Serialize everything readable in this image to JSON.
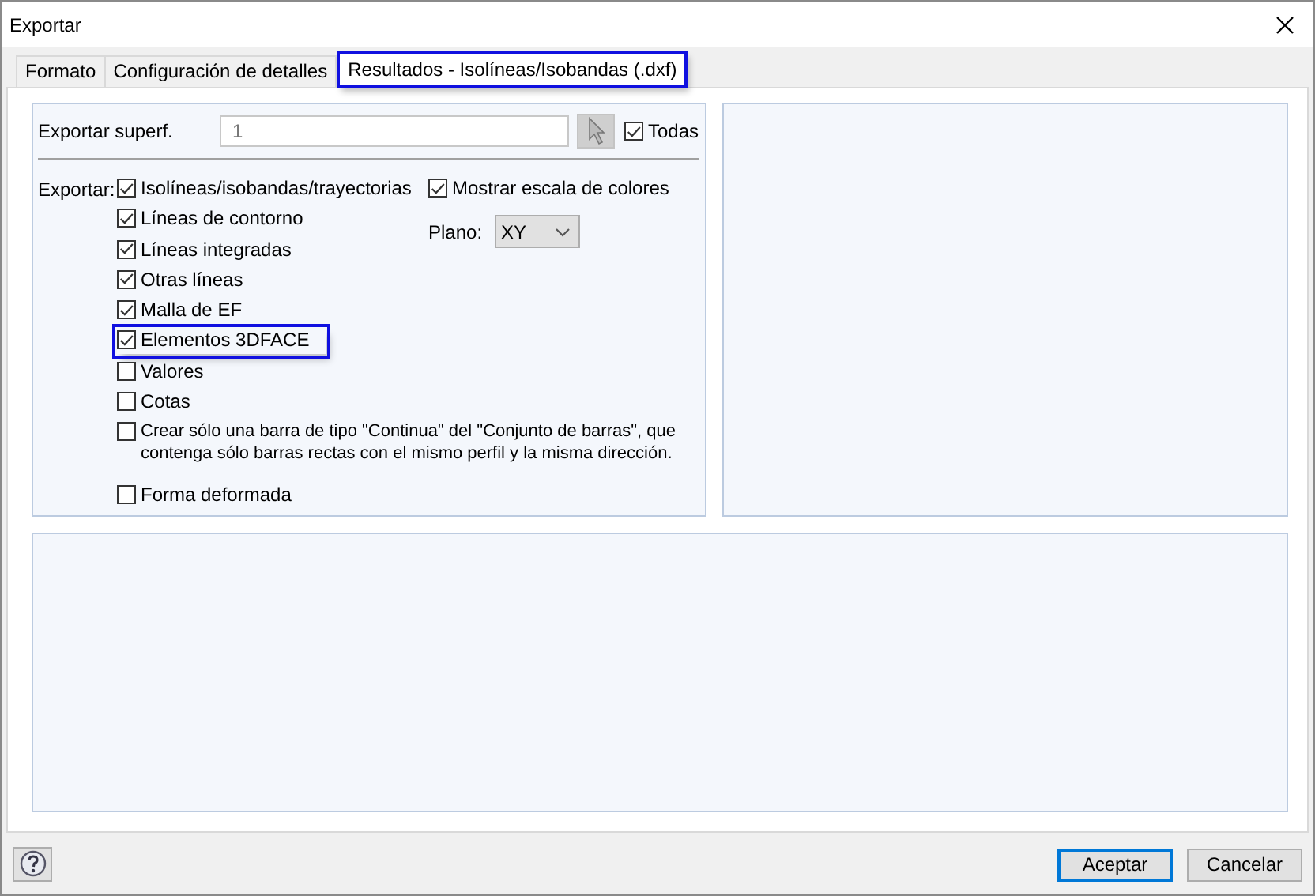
{
  "window": {
    "title": "Exportar"
  },
  "tabs": [
    {
      "label": "Formato",
      "selected": false,
      "highlighted": false
    },
    {
      "label": "Configuración de detalles",
      "selected": false,
      "highlighted": false
    },
    {
      "label": "Resultados - Isolíneas/Isobandas (.dxf)",
      "selected": true,
      "highlighted": true
    }
  ],
  "surface": {
    "label": "Exportar superf.",
    "value": "1",
    "all": {
      "label": "Todas",
      "checked": true
    }
  },
  "export": {
    "label": "Exportar:",
    "options": [
      {
        "label": "Isolíneas/isobandas/trayectorias",
        "checked": true,
        "highlighted": false
      },
      {
        "label": "Líneas de contorno",
        "checked": true,
        "highlighted": false
      },
      {
        "label": "Líneas integradas",
        "checked": true,
        "highlighted": false
      },
      {
        "label": "Otras líneas",
        "checked": true,
        "highlighted": false
      },
      {
        "label": "Malla de EF",
        "checked": true,
        "highlighted": false
      },
      {
        "label": "Elementos 3DFACE",
        "checked": true,
        "highlighted": true
      },
      {
        "label": "Valores",
        "checked": false,
        "highlighted": false
      },
      {
        "label": "Cotas",
        "checked": false,
        "highlighted": false
      },
      {
        "label": "Crear sólo una barra de tipo \"Continua\" del \"Conjunto de barras\", que contenga sólo barras rectas con el mismo perfil y la misma dirección.",
        "checked": false,
        "highlighted": false
      }
    ],
    "deformed": {
      "label": "Forma deformada",
      "checked": false
    }
  },
  "color_scale": {
    "label": "Mostrar escala de colores",
    "checked": true
  },
  "plane": {
    "label": "Plano:",
    "value": "XY"
  },
  "buttons": [
    {
      "label": "Aceptar",
      "default": true
    },
    {
      "label": "Cancelar",
      "default": false
    }
  ]
}
